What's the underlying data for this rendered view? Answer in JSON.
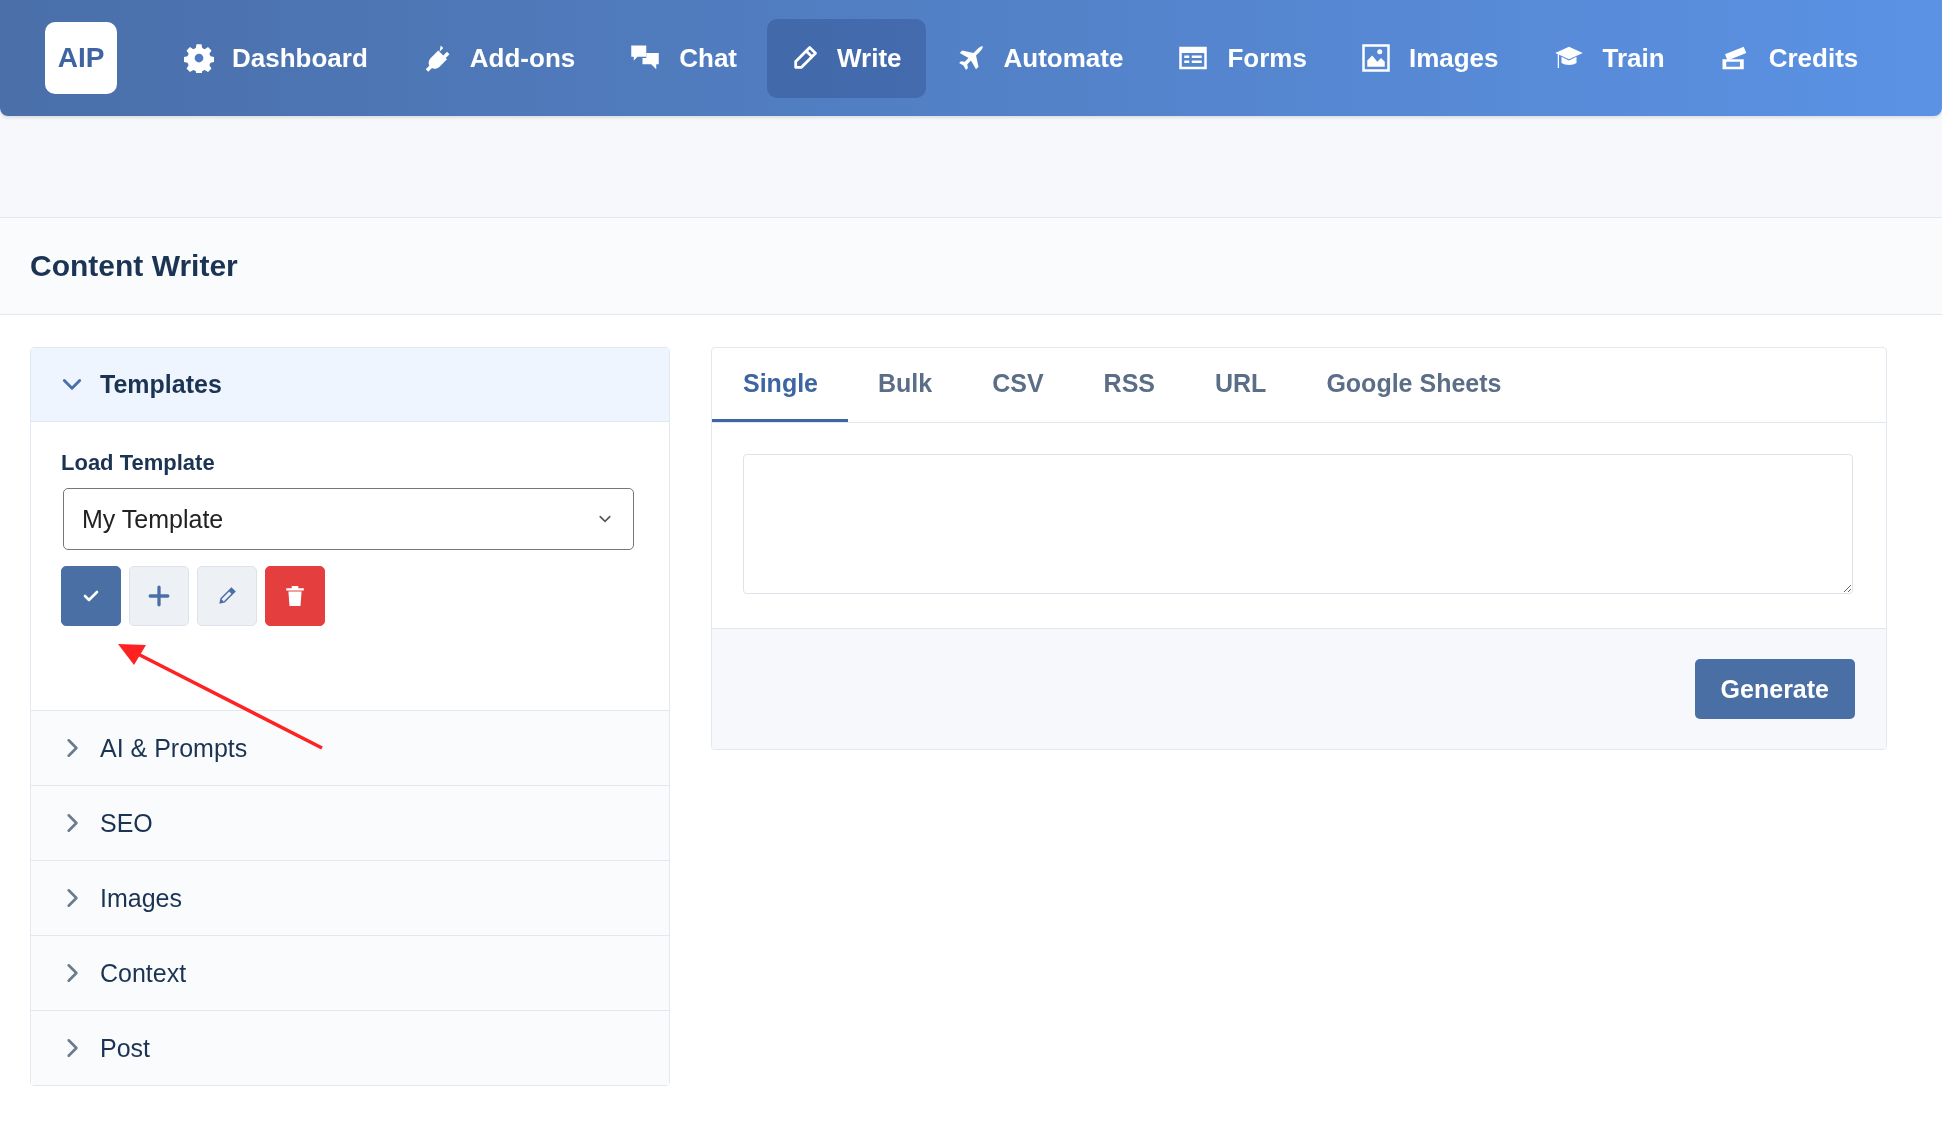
{
  "nav": {
    "logo": "AIP",
    "items": [
      {
        "label": "Dashboard",
        "selected": false
      },
      {
        "label": "Add-ons",
        "selected": false
      },
      {
        "label": "Chat",
        "selected": false
      },
      {
        "label": "Write",
        "selected": true
      },
      {
        "label": "Automate",
        "selected": false
      },
      {
        "label": "Forms",
        "selected": false
      },
      {
        "label": "Images",
        "selected": false
      },
      {
        "label": "Train",
        "selected": false
      },
      {
        "label": "Credits",
        "selected": false
      }
    ]
  },
  "page": {
    "title": "Content Writer"
  },
  "sidebar": {
    "sections": [
      {
        "label": "Templates",
        "expanded": true
      },
      {
        "label": "AI & Prompts",
        "expanded": false
      },
      {
        "label": "SEO",
        "expanded": false
      },
      {
        "label": "Images",
        "expanded": false
      },
      {
        "label": "Context",
        "expanded": false
      },
      {
        "label": "Post",
        "expanded": false
      }
    ],
    "template": {
      "label": "Load Template",
      "value": "My Template",
      "buttons": [
        {
          "kind": "confirm"
        },
        {
          "kind": "add"
        },
        {
          "kind": "edit"
        },
        {
          "kind": "delete"
        }
      ]
    }
  },
  "writer": {
    "tabs": [
      {
        "label": "Single",
        "selected": true
      },
      {
        "label": "Bulk",
        "selected": false
      },
      {
        "label": "CSV",
        "selected": false
      },
      {
        "label": "RSS",
        "selected": false
      },
      {
        "label": "URL",
        "selected": false
      },
      {
        "label": "Google Sheets",
        "selected": false
      }
    ],
    "generate_button": "Generate"
  }
}
